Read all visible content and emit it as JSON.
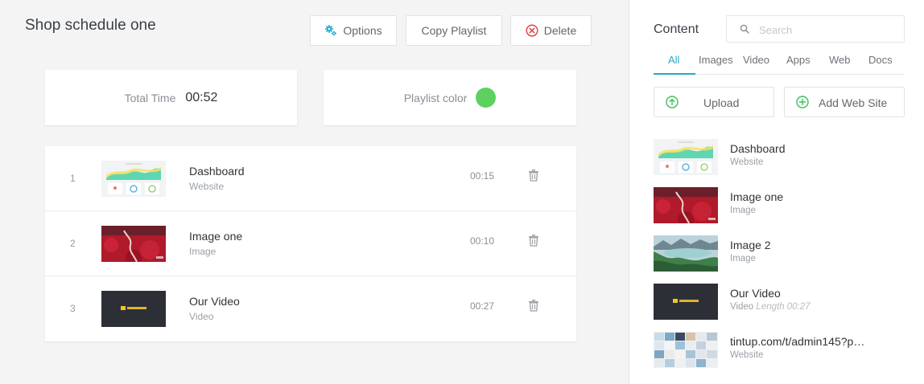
{
  "schedule": {
    "title": "Shop schedule one"
  },
  "toolbar": {
    "options_label": "Options",
    "copy_label": "Copy Playlist",
    "delete_label": "Delete"
  },
  "summary": {
    "total_time_label": "Total Time",
    "total_time_value": "00:52",
    "playlist_color_label": "Playlist color",
    "playlist_color": "#5cd160"
  },
  "playlist": [
    {
      "num": "1",
      "title": "Dashboard",
      "type": "Website",
      "duration": "00:15"
    },
    {
      "num": "2",
      "title": "Image one",
      "type": "Image",
      "duration": "00:10"
    },
    {
      "num": "3",
      "title": "Our Video",
      "type": "Video",
      "duration": "00:27"
    }
  ],
  "content": {
    "title": "Content",
    "search_placeholder": "Search",
    "tabs": [
      {
        "label": "All",
        "active": true
      },
      {
        "label": "Images"
      },
      {
        "label": "Video"
      },
      {
        "label": "Apps"
      },
      {
        "label": "Web"
      },
      {
        "label": "Docs"
      }
    ],
    "upload_label": "Upload",
    "add_web_label": "Add Web Site",
    "items": [
      {
        "title": "Dashboard",
        "type": "Website"
      },
      {
        "title": "Image one",
        "type": "Image"
      },
      {
        "title": "Image 2",
        "type": "Image"
      },
      {
        "title": "Our Video",
        "type": "Video",
        "length": "Length 00:27"
      },
      {
        "title": "tintup.com/t/admin145?p…",
        "type": "Website"
      }
    ]
  },
  "colors": {
    "accent": "#27a9c9",
    "add_green": "#3fbf5a",
    "delete_red": "#e0454c",
    "playlist_color": "#5cd160"
  }
}
